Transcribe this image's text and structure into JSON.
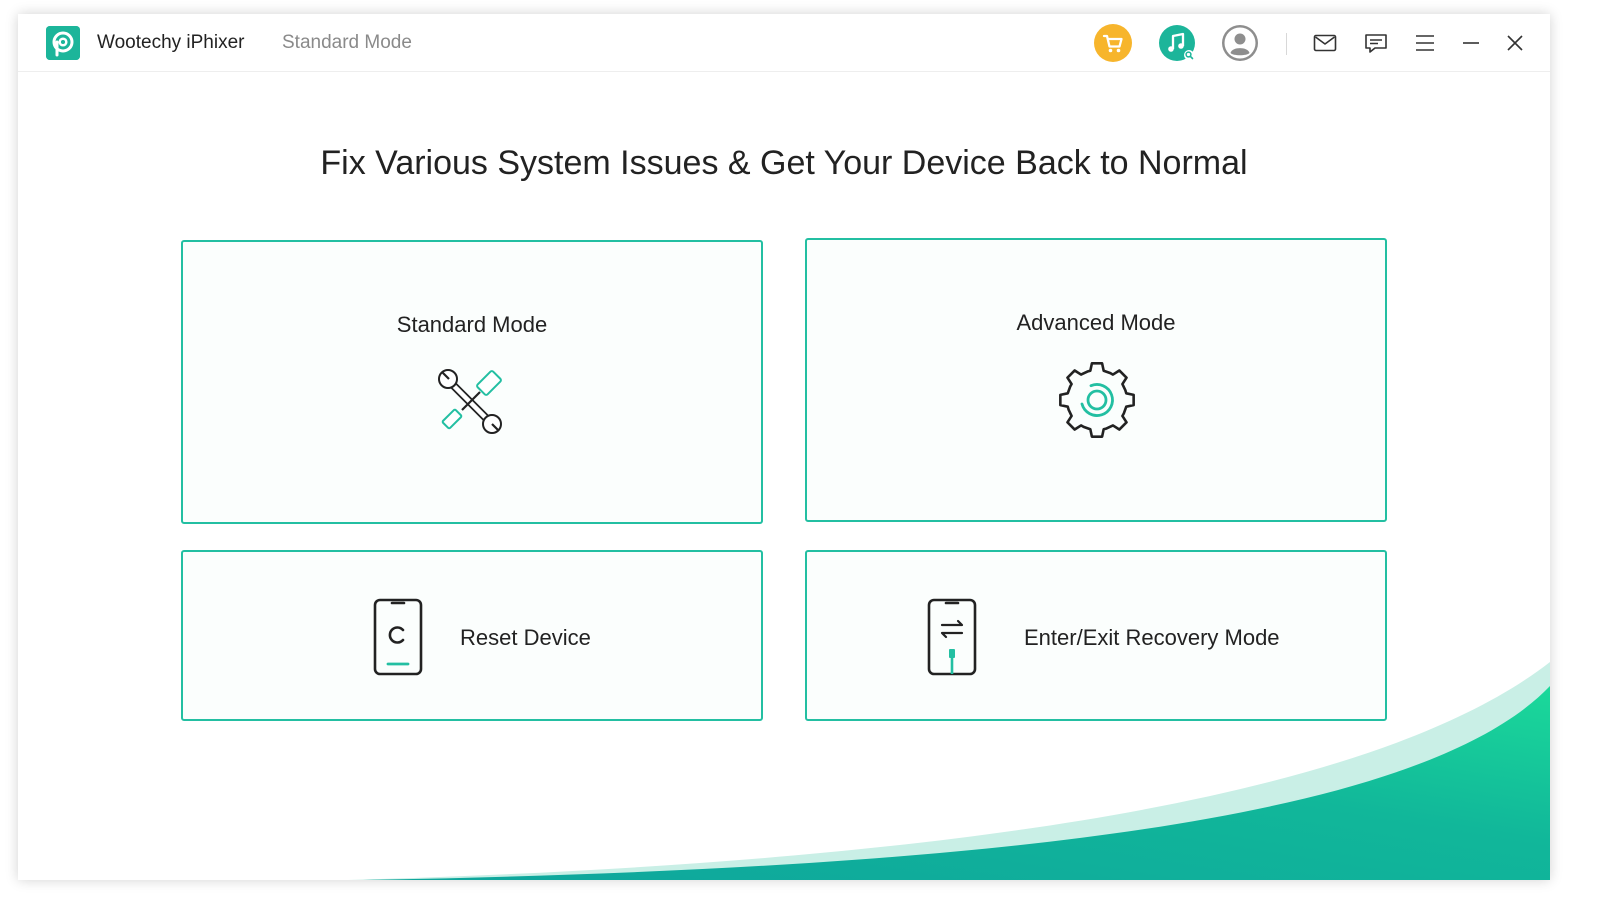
{
  "window": {
    "app_name": "Wootechy iPhixer",
    "mode_name": "Standard Mode"
  },
  "toolbar": {
    "icons": [
      "cart-icon",
      "music-icon",
      "user-icon",
      "mail-icon",
      "feedback-icon",
      "menu-icon",
      "minimize-icon",
      "close-icon"
    ]
  },
  "main": {
    "headline": "Fix Various System Issues & Get Your Device Back to Normal",
    "cards": [
      {
        "label": "Standard Mode",
        "icon": "tools-icon"
      },
      {
        "label": "Advanced Mode",
        "icon": "gear-icon"
      },
      {
        "label": "Reset Device",
        "icon": "phone-reset-icon"
      },
      {
        "label": "Enter/Exit Recovery Mode",
        "icon": "phone-recovery-icon"
      }
    ]
  },
  "colors": {
    "accent": "#23bfa2",
    "cart": "#f7b52c",
    "music": "#1cb59a",
    "user": "#8e8e8e"
  }
}
